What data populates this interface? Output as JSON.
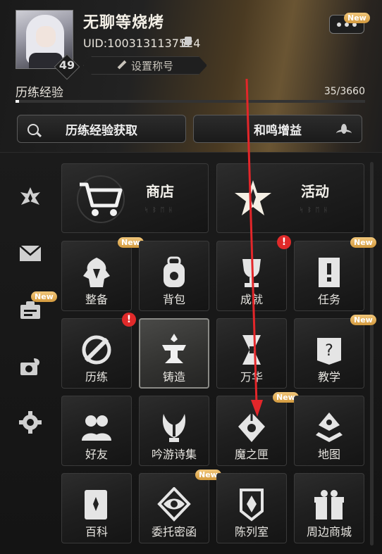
{
  "profile": {
    "username": "无聊等烧烤",
    "uid": "UID:1003131137524",
    "level": "49",
    "title_placeholder": "设置称号"
  },
  "menu": {
    "badge": "New"
  },
  "experience": {
    "label": "历练经验",
    "current": 35,
    "max": 3660,
    "value_text": "35/3660",
    "progress": 0.0096
  },
  "actions": [
    {
      "label": "历练经验获取",
      "icon": "search-icon"
    },
    {
      "label": "和鸣增益",
      "icon": "lotus-icon"
    }
  ],
  "sidebar": [
    {
      "name": "sidebar-emblem",
      "icon": "crest-icon",
      "badge": ""
    },
    {
      "name": "sidebar-mail",
      "icon": "mail-icon",
      "badge": ""
    },
    {
      "name": "sidebar-card",
      "icon": "id-card-icon",
      "badge": "New"
    },
    {
      "name": "sidebar-camera",
      "icon": "camera-icon",
      "badge": ""
    },
    {
      "name": "sidebar-settings",
      "icon": "gear-icon",
      "badge": ""
    }
  ],
  "featured": [
    {
      "label": "商店",
      "sub": "ᛋᛒᛖᚺ",
      "icon": "cart-icon"
    },
    {
      "label": "活动",
      "sub": "ᛋᛒᛖᚺ",
      "icon": "star-emblem-icon"
    }
  ],
  "tiles": [
    {
      "label": "整备",
      "icon": "armor-icon",
      "badge": "New"
    },
    {
      "label": "背包",
      "icon": "backpack-icon",
      "badge": ""
    },
    {
      "label": "成就",
      "icon": "trophy-icon",
      "badge": "!"
    },
    {
      "label": "任务",
      "icon": "quest-scroll-icon",
      "badge": "New"
    },
    {
      "label": "历练",
      "icon": "training-icon",
      "badge": "!"
    },
    {
      "label": "铸造",
      "icon": "anvil-icon",
      "badge": ""
    },
    {
      "label": "万华",
      "icon": "hourglass-icon",
      "badge": ""
    },
    {
      "label": "教学",
      "icon": "help-book-icon",
      "badge": "New"
    },
    {
      "label": "好友",
      "icon": "friends-icon",
      "badge": ""
    },
    {
      "label": "吟游诗集",
      "icon": "lyre-icon",
      "badge": ""
    },
    {
      "label": "魔之匣",
      "icon": "magic-box-icon",
      "badge": "New"
    },
    {
      "label": "地图",
      "icon": "map-icon",
      "badge": ""
    },
    {
      "label": "百科",
      "icon": "encyclopedia-icon",
      "badge": ""
    },
    {
      "label": "委托密函",
      "icon": "eye-seal-icon",
      "badge": "New"
    },
    {
      "label": "陈列室",
      "icon": "showcase-icon",
      "badge": ""
    },
    {
      "label": "周边商城",
      "icon": "gift-icon",
      "badge": ""
    }
  ]
}
